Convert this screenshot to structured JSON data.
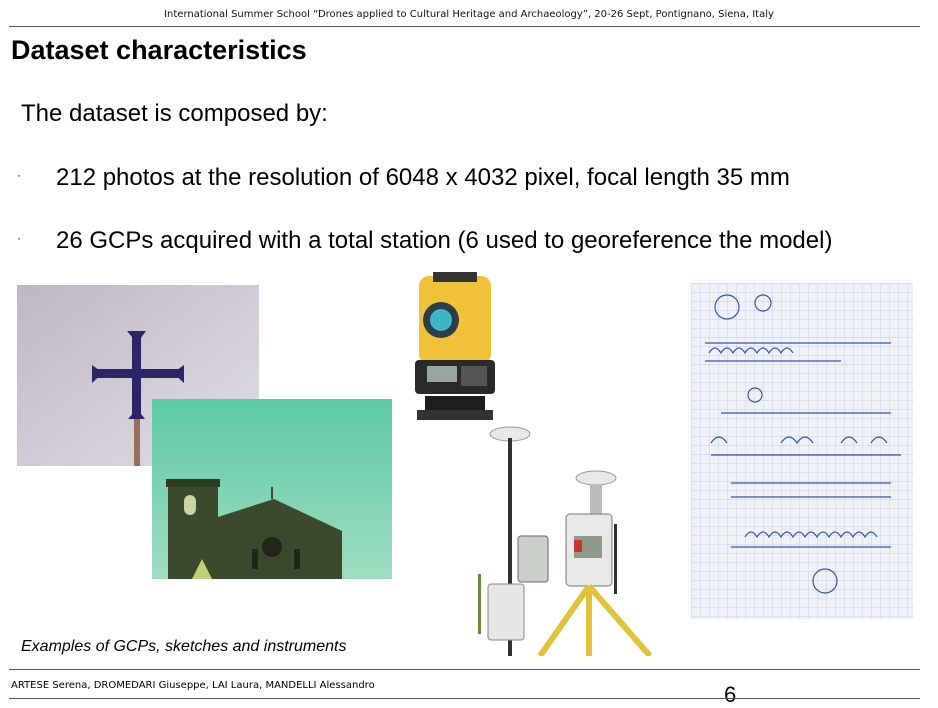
{
  "header": {
    "text": "International Summer School “Drones applied to Cultural Heritage and Archaeology”, 20-26 Sept, Pontignano, Siena, Italy"
  },
  "slide": {
    "title": "Dataset characteristics",
    "intro": "The dataset is composed by:",
    "bullets": [
      {
        "marker": "·",
        "text": "212 photos at the resolution of 6048 x 4032 pixel, focal length 35 mm"
      },
      {
        "marker": "·",
        "text": "26 GCPs acquired with a total station (6 used to georeference the model)"
      }
    ],
    "caption": "Examples of GCPs, sketches and instruments"
  },
  "footer": {
    "authors": "ARTESE Serena, DROMEDARI Giuseppe, LAI Laura, MANDELLI Alessandro",
    "page_number": "6"
  }
}
